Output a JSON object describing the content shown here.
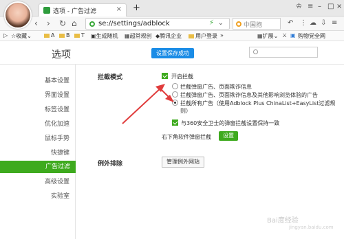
{
  "browser": {
    "tab_title": "选项 - 广告过滤",
    "tab_close": "×",
    "new_tab": "+",
    "url": "se://settings/adblock",
    "search_placeholder": "中国抱",
    "extensions_label": "扩展",
    "shop_label": "购物党全网"
  },
  "bookmarks": {
    "items": [
      "收藏",
      "A",
      "B",
      "T",
      "生成随机",
      "超常规创",
      "腾讯企业",
      "用户登录"
    ]
  },
  "header": {
    "title": "选项",
    "save_status": "设置保存成功"
  },
  "sidebar": {
    "items": [
      "基本设置",
      "界面设置",
      "标签设置",
      "优化加速",
      "鼠标手势",
      "快捷键",
      "广告过滤",
      "高级设置",
      "实验室"
    ],
    "active_index": 6
  },
  "main": {
    "block_mode_label": "拦截模式",
    "enable_block": "开启拦截",
    "options": [
      "拦截弹窗广告、页面欺诈信息",
      "拦截弹窗广告、页面欺诈信息及其他影响浏览体验的广告",
      "拦截所有广告（使用Adblock Plus ChinaList+EasyList过滤规",
      "则）"
    ],
    "sync_360": "与360安全卫士的弹窗拦截设置保持一致",
    "popup_label": "右下角软件弹窗拦截",
    "setup_button": "设置",
    "exclusion_label": "例外排除",
    "manage_button": "管理例外网站"
  },
  "watermark": {
    "main": "Bai度经验",
    "sub": "jingyan.baidu.com"
  },
  "colors": {
    "accent": "#3eaa1e",
    "save_blue": "#1a8ce6",
    "arrow_red": "#e03c3c"
  }
}
